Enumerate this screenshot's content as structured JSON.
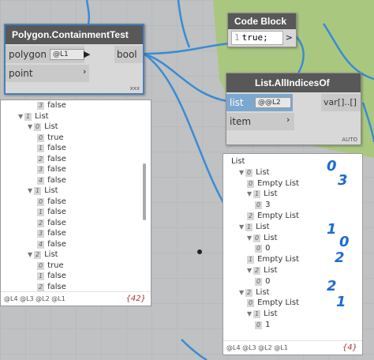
{
  "colors": {
    "wire": "#3b8bd4",
    "canvas": "#bfc1c2",
    "green_region": "#a9c77c",
    "handwriting": "#1d6bd6"
  },
  "containment_node": {
    "title": "Polygon.ContainmentTest",
    "inputs": [
      {
        "label": "polygon",
        "lacing": "@L1"
      },
      {
        "label": "point"
      }
    ],
    "output": "bool",
    "footer": "xxx"
  },
  "codeblock_node": {
    "title": "Code Block",
    "line_number": "1",
    "code": "true;",
    "output": ">"
  },
  "allindices_node": {
    "title": "List.AllIndicesOf",
    "inputs": [
      {
        "label": "list",
        "lacing": "@@L2"
      },
      {
        "label": "item"
      }
    ],
    "output": "var[]..[]",
    "footer": "AUTO"
  },
  "left_preview": {
    "lines": [
      {
        "depth": 3,
        "idx": "3",
        "text": "false"
      },
      {
        "depth": 1,
        "arrow": "▼",
        "idx": "1",
        "text": "List"
      },
      {
        "depth": 2,
        "arrow": "▼",
        "idx": "0",
        "text": "List"
      },
      {
        "depth": 3,
        "idx": "0",
        "text": "true"
      },
      {
        "depth": 3,
        "idx": "1",
        "text": "false"
      },
      {
        "depth": 3,
        "idx": "2",
        "text": "false"
      },
      {
        "depth": 3,
        "idx": "3",
        "text": "false"
      },
      {
        "depth": 3,
        "idx": "4",
        "text": "false"
      },
      {
        "depth": 2,
        "arrow": "▼",
        "idx": "1",
        "text": "List"
      },
      {
        "depth": 3,
        "idx": "0",
        "text": "false"
      },
      {
        "depth": 3,
        "idx": "1",
        "text": "false"
      },
      {
        "depth": 3,
        "idx": "2",
        "text": "false"
      },
      {
        "depth": 3,
        "idx": "3",
        "text": "false"
      },
      {
        "depth": 3,
        "idx": "4",
        "text": "false"
      },
      {
        "depth": 2,
        "arrow": "▼",
        "idx": "2",
        "text": "List"
      },
      {
        "depth": 3,
        "idx": "0",
        "text": "true"
      },
      {
        "depth": 3,
        "idx": "1",
        "text": "false"
      },
      {
        "depth": 3,
        "idx": "2",
        "text": "false"
      }
    ],
    "levels": "@L4 @L3 @L2 @L1",
    "count": "{42}"
  },
  "right_preview": {
    "lines": [
      {
        "depth": 0,
        "text": "List"
      },
      {
        "depth": 1,
        "arrow": "▼",
        "idx": "0",
        "text": "List"
      },
      {
        "depth": 2,
        "idx": "0",
        "text": "Empty List"
      },
      {
        "depth": 2,
        "arrow": "▼",
        "idx": "1",
        "text": "List"
      },
      {
        "depth": 3,
        "idx": "0",
        "text": "3"
      },
      {
        "depth": 2,
        "idx": "2",
        "text": "Empty List"
      },
      {
        "depth": 1,
        "arrow": "▼",
        "idx": "1",
        "text": "List"
      },
      {
        "depth": 2,
        "arrow": "▼",
        "idx": "0",
        "text": "List"
      },
      {
        "depth": 3,
        "idx": "0",
        "text": "0"
      },
      {
        "depth": 2,
        "idx": "1",
        "text": "Empty List"
      },
      {
        "depth": 2,
        "arrow": "▼",
        "idx": "2",
        "text": "List"
      },
      {
        "depth": 3,
        "idx": "0",
        "text": "0"
      },
      {
        "depth": 1,
        "arrow": "▼",
        "idx": "2",
        "text": "List"
      },
      {
        "depth": 2,
        "idx": "0",
        "text": "Empty List"
      },
      {
        "depth": 2,
        "arrow": "▼",
        "idx": "1",
        "text": "List"
      },
      {
        "depth": 3,
        "idx": "0",
        "text": "1"
      }
    ],
    "levels": "@L4 @L3 @L2 @L1",
    "count": "{4}"
  },
  "annotations": [
    "0",
    "3",
    "1",
    "0",
    "2",
    "2",
    "1"
  ]
}
